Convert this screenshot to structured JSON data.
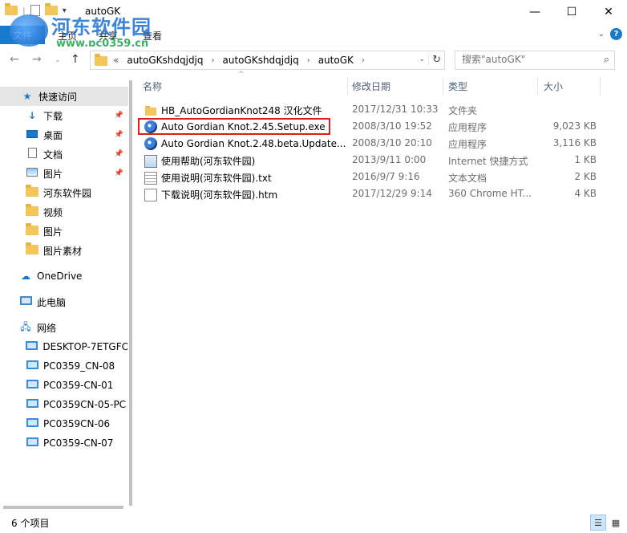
{
  "window": {
    "title": "autoGK",
    "minimize": "—",
    "maximize": "☐",
    "close": "✕"
  },
  "watermark": {
    "name": "河东软件园",
    "url": "www.pc0359.cn"
  },
  "ribbon": {
    "file_tab": "文件",
    "tabs": [
      "主页",
      "共享",
      "查看"
    ],
    "help": "?"
  },
  "address": {
    "prefix": "«",
    "crumbs": [
      "autoGKshdqjdjq",
      "autoGKshdqjdjq",
      "autoGK"
    ],
    "separator": "›"
  },
  "search": {
    "placeholder": "搜索\"autoGK\""
  },
  "navpane": {
    "items": [
      {
        "label": "快速访问",
        "icon": "star-icon"
      },
      {
        "label": "下载",
        "icon": "download-icon"
      },
      {
        "label": "桌面",
        "icon": "desktop-icon"
      },
      {
        "label": "文档",
        "icon": "document-icon"
      },
      {
        "label": "图片",
        "icon": "picture-icon"
      },
      {
        "label": "河东软件园",
        "icon": "folder-icon"
      },
      {
        "label": "视频",
        "icon": "folder-icon"
      },
      {
        "label": "图片",
        "icon": "folder-icon"
      },
      {
        "label": "图片素材",
        "icon": "folder-icon"
      },
      {
        "label": "OneDrive",
        "icon": "cloud-icon"
      },
      {
        "label": "此电脑",
        "icon": "pc-icon"
      },
      {
        "label": "网络",
        "icon": "network-icon"
      },
      {
        "label": "DESKTOP-7ETGFC",
        "icon": "computer-icon"
      },
      {
        "label": "PC0359_CN-08",
        "icon": "computer-icon"
      },
      {
        "label": "PC0359-CN-01",
        "icon": "computer-icon"
      },
      {
        "label": "PC0359CN-05-PC",
        "icon": "computer-icon"
      },
      {
        "label": "PC0359CN-06",
        "icon": "computer-icon"
      },
      {
        "label": "PC0359-CN-07",
        "icon": "computer-icon"
      }
    ]
  },
  "columns": {
    "name": "名称",
    "date": "修改日期",
    "type": "类型",
    "size": "大小"
  },
  "files": [
    {
      "name": "HB_AutoGordianKnot248 汉化文件",
      "date": "2017/12/31 10:33",
      "type": "文件夹",
      "size": "",
      "icon": "folder-icon"
    },
    {
      "name": "Auto Gordian Knot.2.45.Setup.exe",
      "date": "2008/3/10 19:52",
      "type": "应用程序",
      "size": "9,023 KB",
      "icon": "exe-icon"
    },
    {
      "name": "Auto Gordian Knot.2.48.beta.Update....",
      "date": "2008/3/10 20:10",
      "type": "应用程序",
      "size": "3,116 KB",
      "icon": "exe-icon"
    },
    {
      "name": "使用帮助(河东软件园)",
      "date": "2013/9/11 0:00",
      "type": "Internet 快捷方式",
      "size": "1 KB",
      "icon": "url-icon"
    },
    {
      "name": "使用说明(河东软件园).txt",
      "date": "2016/9/7 9:16",
      "type": "文本文档",
      "size": "2 KB",
      "icon": "txt-icon"
    },
    {
      "name": "下载说明(河东软件园).htm",
      "date": "2017/12/29 9:14",
      "type": "360 Chrome HT...",
      "size": "4 KB",
      "icon": "htm-icon"
    }
  ],
  "status": {
    "count": "6 个项目"
  },
  "colors": {
    "accent": "#1979ca",
    "highlight": "#e01b1b"
  }
}
